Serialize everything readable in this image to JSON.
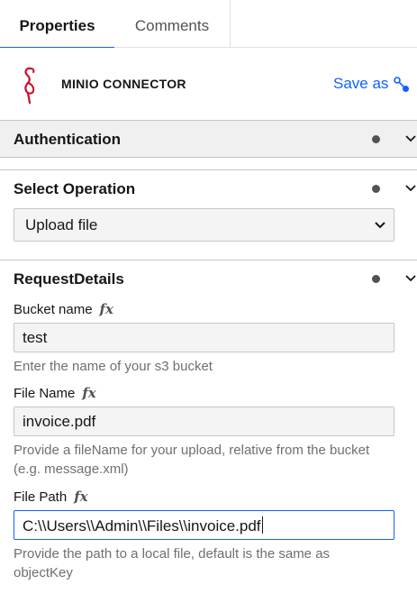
{
  "tabs": [
    {
      "label": "Properties",
      "active": true
    },
    {
      "label": "Comments",
      "active": false
    }
  ],
  "header": {
    "title": "MINIO CONNECTOR",
    "save_as": "Save as",
    "logo_icon": "flamingo-logo-icon",
    "accent_color": "#0f62fe"
  },
  "groups": {
    "authentication": {
      "title": "Authentication"
    },
    "select_operation": {
      "title": "Select Operation",
      "value": "Upload file"
    },
    "request_details": {
      "title": "RequestDetails",
      "fields": [
        {
          "label": "Bucket name",
          "fx": "fx",
          "value": "test",
          "help": "Enter the name of your s3 bucket"
        },
        {
          "label": "File Name",
          "fx": "fx",
          "value": "invoice.pdf",
          "help": "Provide a fileName for your upload, relative from the bucket (e.g. message.xml)"
        },
        {
          "label": "File Path",
          "fx": "fx",
          "value": "C:\\\\Users\\\\Admin\\\\Files\\\\invoice.pdf",
          "help": "Provide the path to a local file, default is the same as objectKey"
        }
      ]
    }
  }
}
